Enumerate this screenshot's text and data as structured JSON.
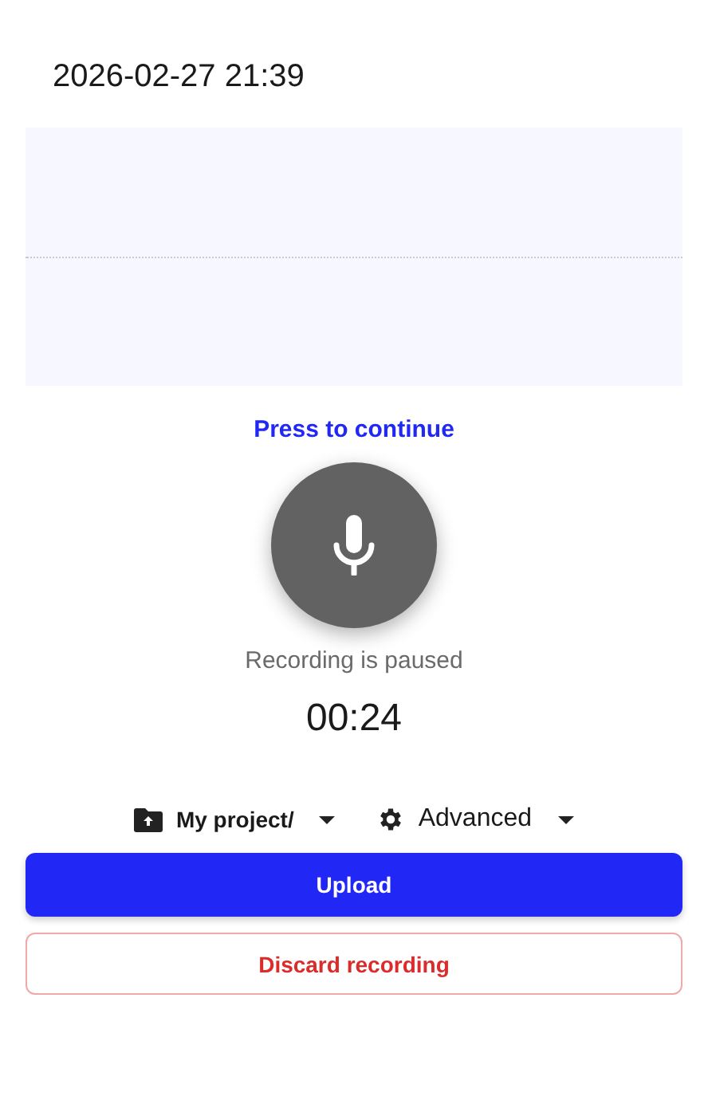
{
  "title": "2026-02-27 21:39",
  "prompt": "Press to continue",
  "status": "Recording is paused",
  "timer": "00:24",
  "options": [
    {
      "kind": "folder",
      "label": "My project/"
    },
    {
      "kind": "settings",
      "label": "Advanced"
    }
  ],
  "buttons": [
    {
      "kind": "primary",
      "label": "Upload"
    },
    {
      "kind": "danger",
      "label": "Discard recording"
    }
  ]
}
